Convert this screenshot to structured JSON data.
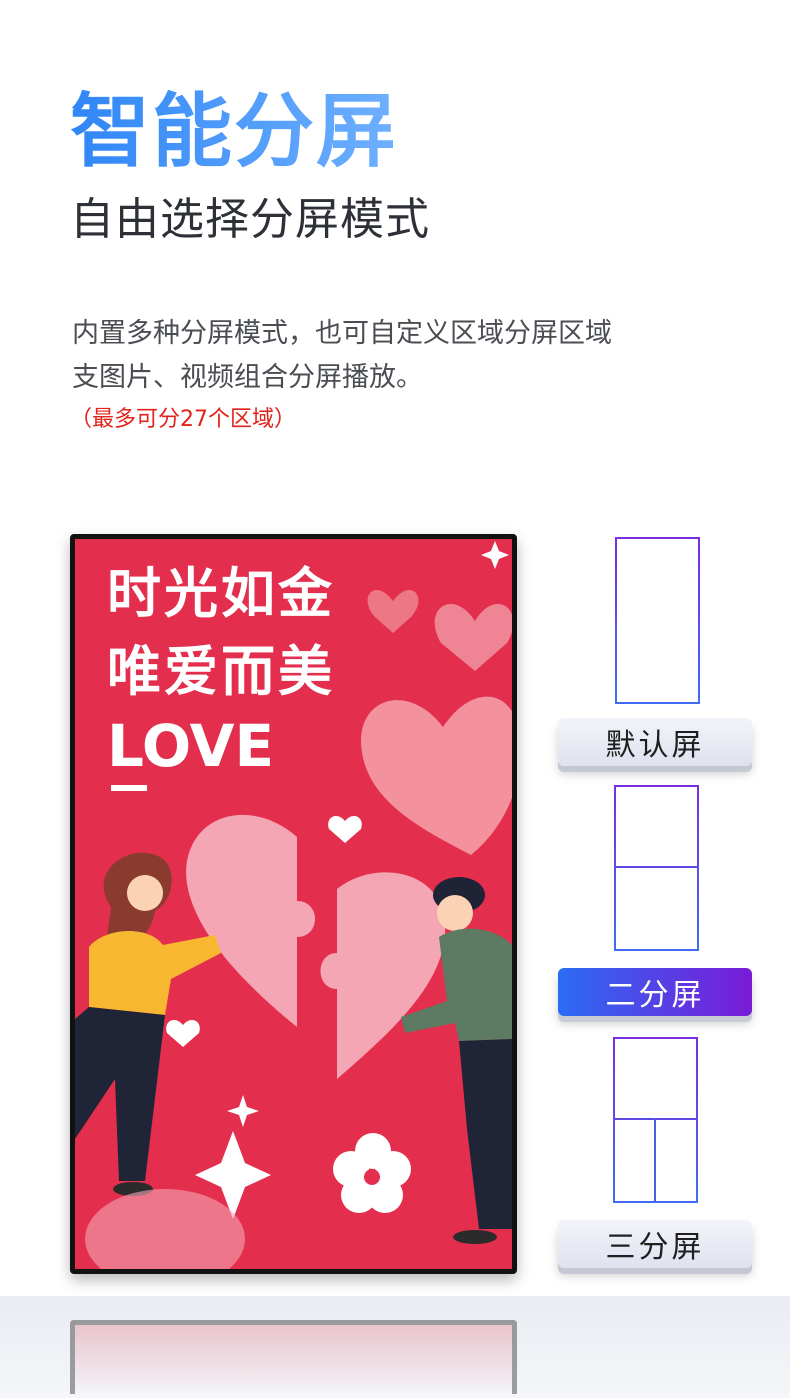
{
  "header": {
    "title": "智能分屏",
    "subtitle": "自由选择分屏模式"
  },
  "description": {
    "line1": "内置多种分屏模式，也可自定义区域分屏区域",
    "line2": "支图片、视频组合分屏播放。",
    "note": "（最多可分27个区域）"
  },
  "poster": {
    "line1": "时光如金",
    "line2": "唯爱而美",
    "line3": "LOVE"
  },
  "modes": [
    {
      "label": "默认屏",
      "selected": false,
      "regions": 1
    },
    {
      "label": "二分屏",
      "selected": true,
      "regions": 2
    },
    {
      "label": "三分屏",
      "selected": false,
      "regions": 3
    }
  ],
  "colors": {
    "title_gradient": [
      "#2f86f6",
      "#6fb0ff"
    ],
    "poster_bg": "#e32f4d",
    "active_button": [
      "#2b6cf4",
      "#7a1bd6"
    ],
    "note": "#e0241b"
  }
}
